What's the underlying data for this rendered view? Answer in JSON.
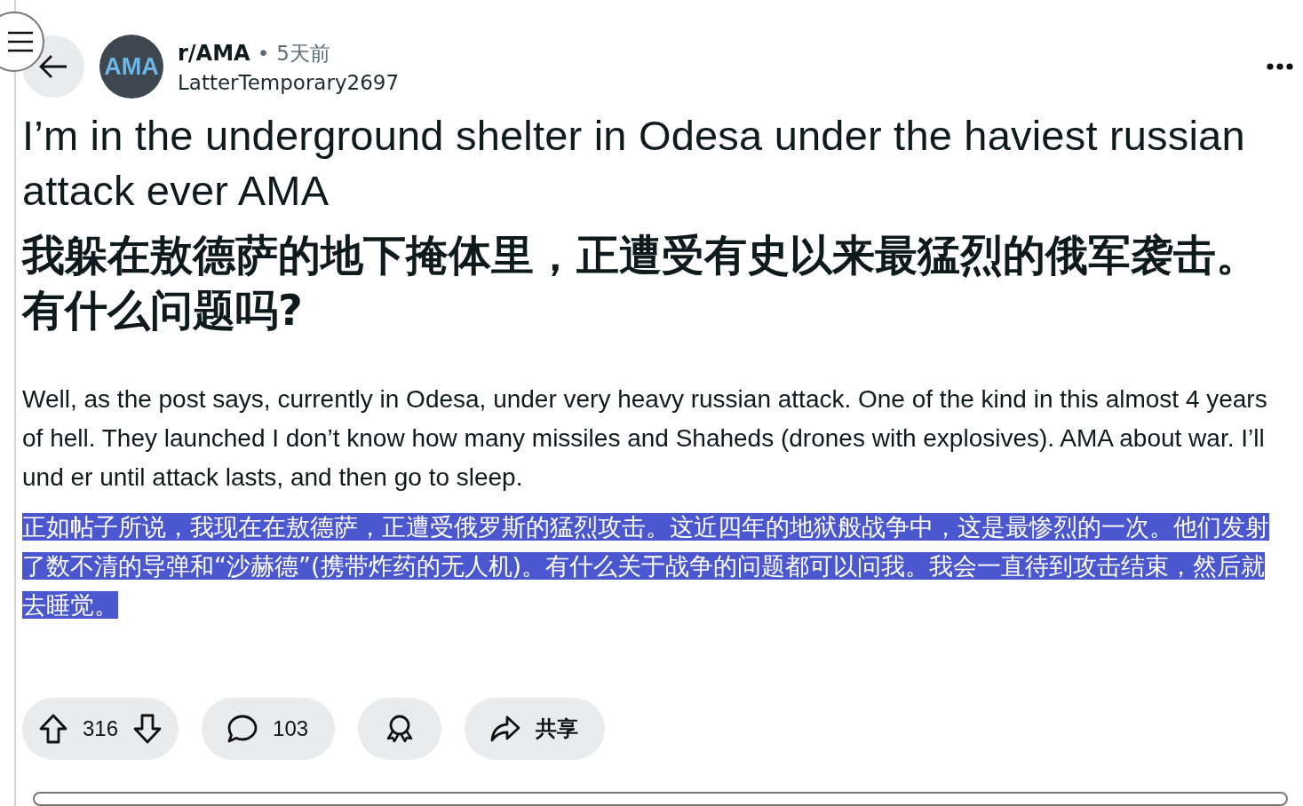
{
  "post": {
    "subreddit": "r/AMA",
    "separator": "•",
    "age": "5天前",
    "author": "LatterTemporary2697",
    "avatar_text": "AMA",
    "titles": [
      "I’m in the underground shelter in Odesa under the haviest russian attack ever AMA",
      "我躲在敖德萨的地下掩体里，正遭受有史以来最猛烈的俄军袭击。有什么问题吗?"
    ],
    "paragraphs": [
      {
        "text": "Well, as the post says, currently in Odesa, under very heavy russian attack. One of the kind in this almost 4 years of hell. They launched I don’t know how many missiles and Shaheds (drones with explosives). AMA about war. I’ll und er until attack lasts, and then go to sleep.",
        "selected": false
      },
      {
        "text": "正如帖子所说，我现在在敖德萨，正遭受俄罗斯的猛烈攻击。这近四年的地狱般战争中，这是最惨烈的一次。他们发射了数不清的导弹和“沙赫德”(携带炸药的无人机)。有什么关于战争的问题都可以问我。我会一直待到攻击结束，然后就去睡觉。",
        "selected": true
      }
    ],
    "votes": "316",
    "comments": "103",
    "share": "共享"
  }
}
